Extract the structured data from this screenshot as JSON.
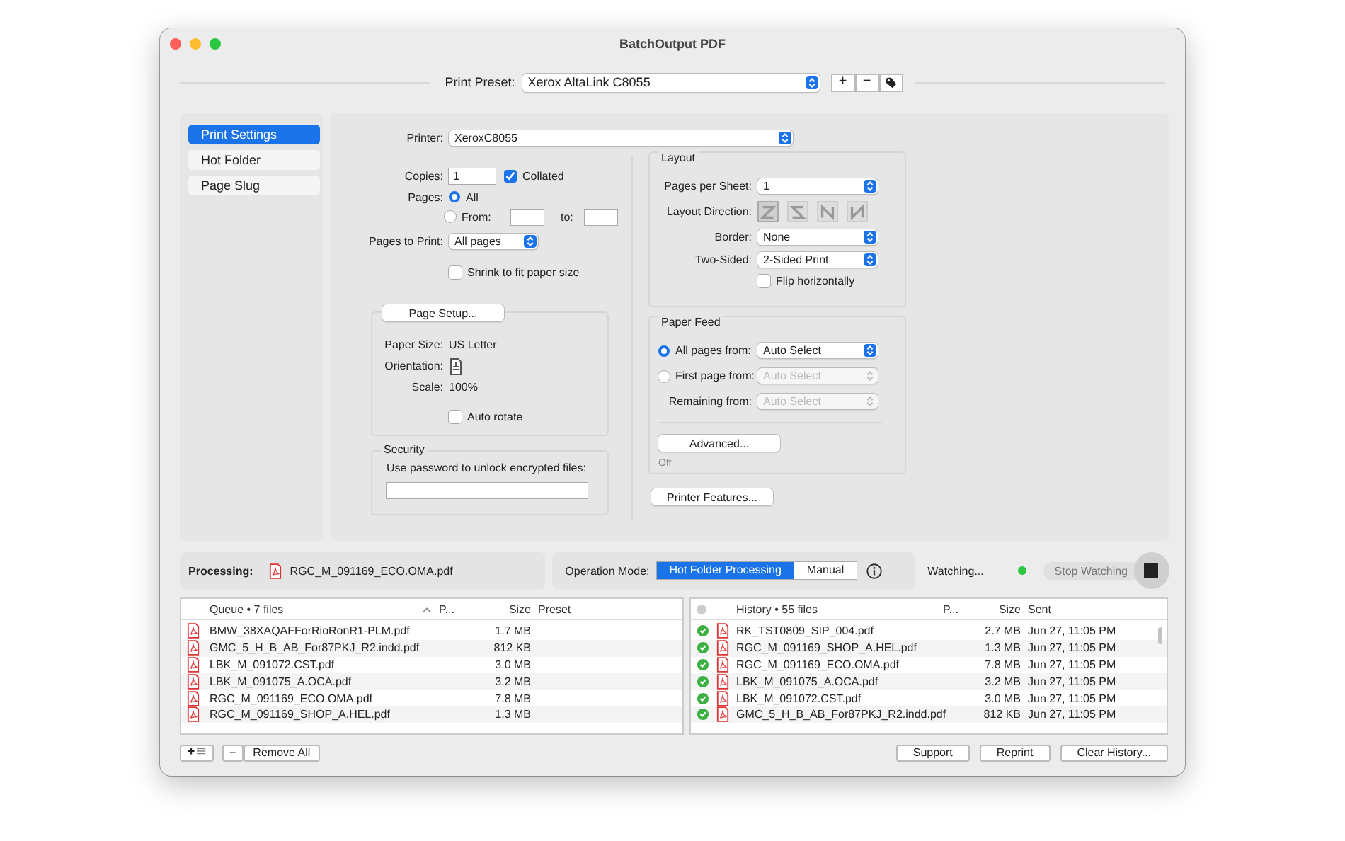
{
  "window": {
    "title": "BatchOutput PDF"
  },
  "preset": {
    "label": "Print Preset:",
    "value": "Xerox AltaLink C8055",
    "add_label": "+",
    "remove_label": "−"
  },
  "sidebar": {
    "items": [
      {
        "label": "Print Settings",
        "selected": true
      },
      {
        "label": "Hot Folder",
        "selected": false
      },
      {
        "label": "Page Slug",
        "selected": false
      }
    ]
  },
  "printer": {
    "label": "Printer:",
    "value": "XeroxC8055"
  },
  "copies": {
    "label": "Copies:",
    "value": "1",
    "collated_label": "Collated",
    "collated": true
  },
  "pages": {
    "label": "Pages:",
    "options": [
      {
        "label": "All",
        "selected": true
      },
      {
        "label": "From:",
        "selected": false
      }
    ],
    "to_label": "to:"
  },
  "pages_to_print": {
    "label": "Pages to Print:",
    "value": "All pages"
  },
  "shrink": {
    "label": "Shrink to fit paper size",
    "checked": false
  },
  "page_setup": {
    "button": "Page Setup...",
    "paper_size_label": "Paper Size:",
    "paper_size": "US Letter",
    "orientation_label": "Orientation:",
    "scale_label": "Scale:",
    "scale": "100%",
    "auto_rotate": {
      "label": "Auto rotate",
      "checked": false
    }
  },
  "security": {
    "title": "Security",
    "label": "Use password to unlock encrypted files:"
  },
  "layout": {
    "title": "Layout",
    "pages_per_sheet": {
      "label": "Pages per Sheet:",
      "value": "1"
    },
    "direction": {
      "label": "Layout Direction:",
      "options": [
        {
          "kind": "z",
          "selected": true
        },
        {
          "kind": "s",
          "selected": false
        },
        {
          "kind": "n-reversed",
          "selected": false
        },
        {
          "kind": "n",
          "selected": false
        }
      ]
    },
    "border": {
      "label": "Border:",
      "value": "None"
    },
    "two_sided": {
      "label": "Two-Sided:",
      "value": "2-Sided Print"
    },
    "flip": {
      "label": "Flip horizontally",
      "checked": false
    }
  },
  "paper_feed": {
    "title": "Paper Feed",
    "options": [
      {
        "label": "All pages from:",
        "value": "Auto Select",
        "selected": true,
        "disabled": false
      },
      {
        "label": "First page from:",
        "value": "Auto Select",
        "selected": false,
        "disabled": true
      }
    ],
    "remaining": {
      "label": "Remaining from:",
      "value": "Auto Select",
      "disabled": true
    },
    "advanced": "Advanced...",
    "status": "Off"
  },
  "printer_features": "Printer Features...",
  "processing": {
    "label": "Processing:",
    "file": "RGC_M_091169_ECO.OMA.pdf"
  },
  "operation_mode": {
    "label": "Operation Mode:",
    "options": [
      {
        "label": "Hot Folder Processing",
        "selected": true
      },
      {
        "label": "Manual",
        "selected": false
      }
    ]
  },
  "watching": {
    "label": "Watching...",
    "active": true,
    "stop_label": "Stop Watching"
  },
  "queue": {
    "columns": [
      "Queue • 7 files",
      "P...",
      "Size",
      "Preset"
    ],
    "rows": [
      {
        "name": "BMW_38XAQAFForRioRonR1-PLM.pdf",
        "size": "1.7 MB"
      },
      {
        "name": "GMC_5_H_B_AB_For87PKJ_R2.indd.pdf",
        "size": "812 KB"
      },
      {
        "name": "LBK_M_091072.CST.pdf",
        "size": "3.0 MB"
      },
      {
        "name": "LBK_M_091075_A.OCA.pdf",
        "size": "3.2 MB"
      },
      {
        "name": "RGC_M_091169_ECO.OMA.pdf",
        "size": "7.8 MB"
      },
      {
        "name": "RGC_M_091169_SHOP_A.HEL.pdf",
        "size": "1.3 MB"
      }
    ],
    "remove_label": "−",
    "remove_all": "Remove All"
  },
  "history": {
    "columns": [
      "History • 55 files",
      "P...",
      "Size",
      "Sent"
    ],
    "rows": [
      {
        "name": "RK_TST0809_SIP_004.pdf",
        "size": "2.7 MB",
        "sent": "Jun 27, 11:05 PM",
        "done": true
      },
      {
        "name": "RGC_M_091169_SHOP_A.HEL.pdf",
        "size": "1.3 MB",
        "sent": "Jun 27, 11:05 PM",
        "done": true
      },
      {
        "name": "RGC_M_091169_ECO.OMA.pdf",
        "size": "7.8 MB",
        "sent": "Jun 27, 11:05 PM",
        "done": true
      },
      {
        "name": "LBK_M_091075_A.OCA.pdf",
        "size": "3.2 MB",
        "sent": "Jun 27, 11:05 PM",
        "done": true
      },
      {
        "name": "LBK_M_091072.CST.pdf",
        "size": "3.0 MB",
        "sent": "Jun 27, 11:05 PM",
        "done": true
      },
      {
        "name": "GMC_5_H_B_AB_For87PKJ_R2.indd.pdf",
        "size": "812 KB",
        "sent": "Jun 27, 11:05 PM",
        "done": true
      }
    ]
  },
  "footer_buttons": [
    "Support",
    "Reprint",
    "Clear History..."
  ]
}
